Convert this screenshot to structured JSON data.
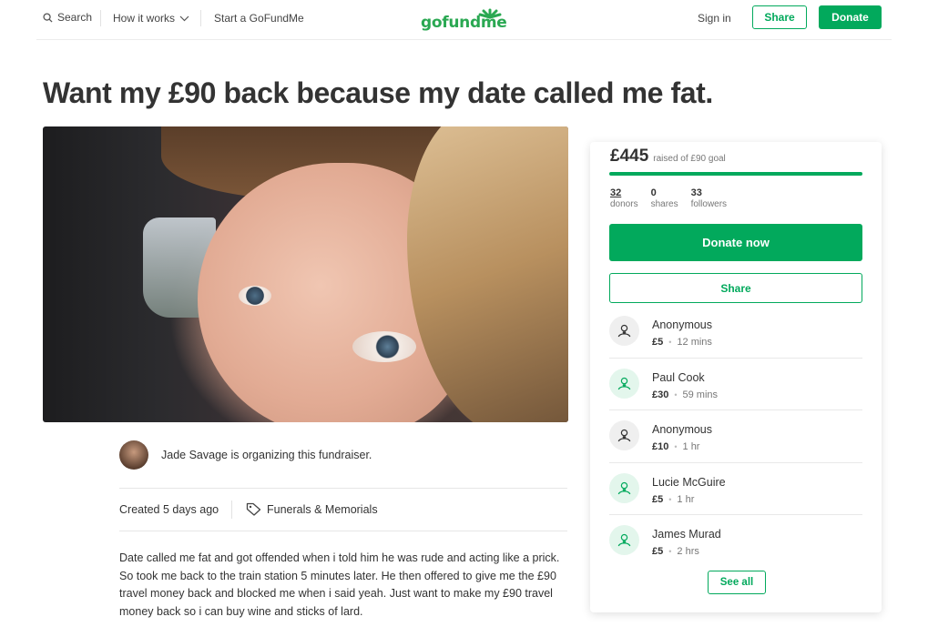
{
  "header": {
    "search_label": "Search",
    "how_it_works_label": "How it works",
    "start_label": "Start a GoFundMe",
    "logo_text": "gofundme",
    "signin_label": "Sign in",
    "share_label": "Share",
    "donate_label": "Donate"
  },
  "campaign": {
    "title": "Want my £90 back because my date called me fat.",
    "organizer_text": "Jade Savage is organizing this fundraiser.",
    "created": "Created 5 days ago",
    "category": "Funerals & Memorials",
    "story": "Date called me fat and got offended when i told him he was rude and acting like a prick. So took me back to the train station 5 minutes later. He then offered to give me the £90 travel money back and blocked me when i said yeah. Just want to make my £90 travel money back so i can buy wine and sticks of lard."
  },
  "donation_card": {
    "raised": "£445",
    "goal_text": "raised of £90 goal",
    "progress_fraction": 1.0,
    "stats": [
      {
        "value": "32",
        "label": "donors"
      },
      {
        "value": "0",
        "label": "shares"
      },
      {
        "value": "33",
        "label": "followers"
      }
    ],
    "donate_now_label": "Donate now",
    "share_label": "Share",
    "see_all_label": "See all",
    "donations": [
      {
        "name": "Anonymous",
        "amount": "£5",
        "time": "12 mins",
        "icon": "donor-icon",
        "style": "grey"
      },
      {
        "name": "Paul Cook",
        "amount": "£30",
        "time": "59 mins",
        "icon": "donor-icon",
        "style": "green"
      },
      {
        "name": "Anonymous",
        "amount": "£10",
        "time": "1 hr",
        "icon": "donor-icon",
        "style": "grey"
      },
      {
        "name": "Lucie McGuire",
        "amount": "£5",
        "time": "1 hr",
        "icon": "donor-icon",
        "style": "green"
      },
      {
        "name": "James Murad",
        "amount": "£5",
        "time": "2 hrs",
        "icon": "donor-icon",
        "style": "green"
      }
    ]
  },
  "colors": {
    "brand_green": "#02a95c",
    "text": "#333333",
    "muted": "#777777"
  }
}
